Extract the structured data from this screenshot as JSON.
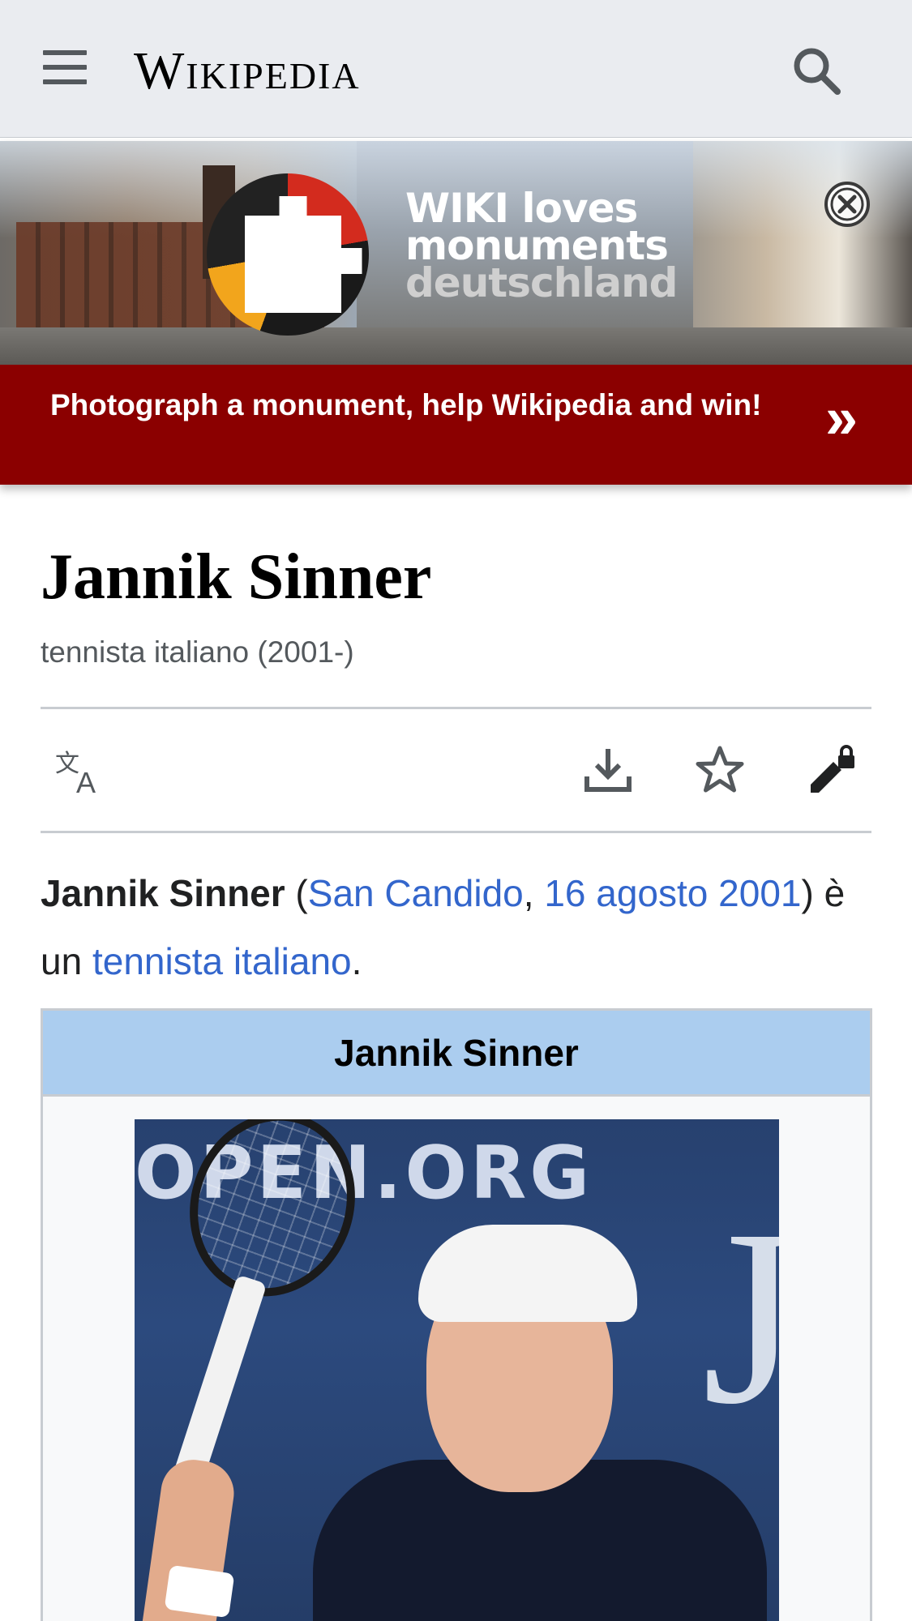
{
  "header": {
    "logo_text": "Wikipedia",
    "menu_icon": "hamburger-menu-icon",
    "search_icon": "search-icon"
  },
  "banner": {
    "overlay_line1": "WIKI loves",
    "overlay_line2": "monuments",
    "overlay_line3": "deutschland",
    "message": "Photograph a monument, help Wikipedia and win!",
    "arrow_glyph": "»",
    "close_icon": "close-circle-icon",
    "strip_color": "#8b0000"
  },
  "article": {
    "title": "Jannik Sinner",
    "description": "tennista italiano (2001-)"
  },
  "toolbar": {
    "language_icon": "language-icon",
    "download_icon": "download-icon",
    "watch_icon": "star-icon",
    "edit_icon": "edit-locked-icon"
  },
  "lead": {
    "name": "Jannik Sinner",
    "open_paren": " (",
    "birthplace": "San Candido",
    "comma": ", ",
    "birthdate": "16 agosto 2001",
    "mid_text": ") è un ",
    "occupation": "tennista italiano",
    "end": "."
  },
  "infobox": {
    "header": "Jannik Sinner",
    "header_color": "#abcdef",
    "photo_sign_text": "OPEN.ORG",
    "photo_letter": "J"
  },
  "colors": {
    "link": "#3366cc",
    "header_bg": "#eaecf0"
  }
}
